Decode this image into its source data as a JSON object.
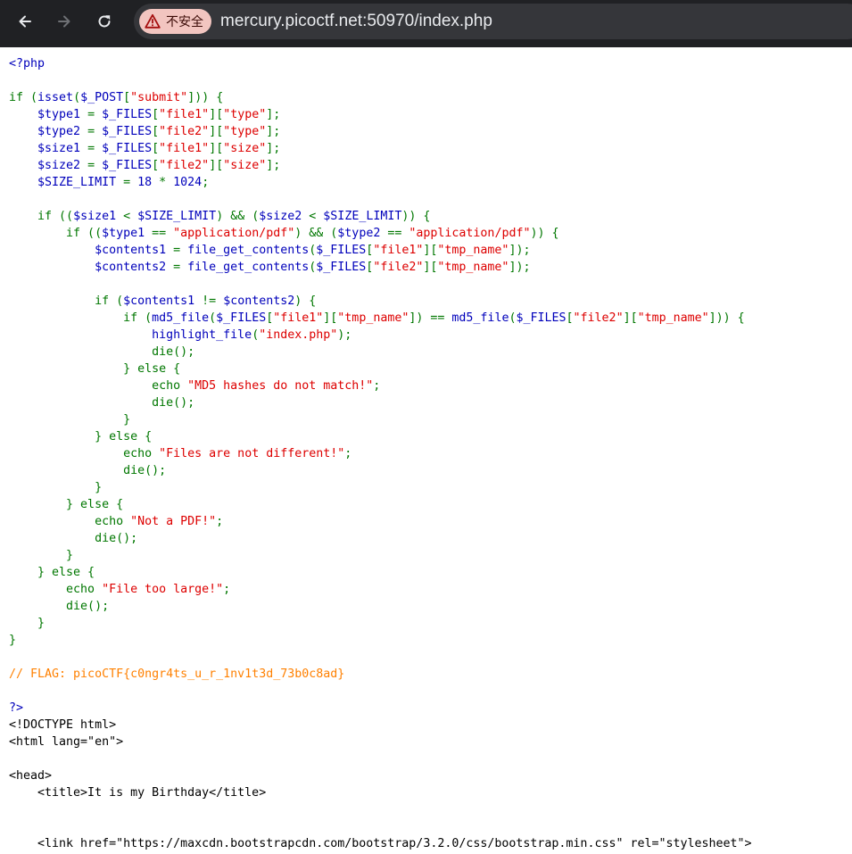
{
  "browser": {
    "security_label": "不安全",
    "url": "mercury.picoctf.net:50970/index.php",
    "icons": {
      "back": "arrow-left-icon",
      "forward": "arrow-right-icon",
      "reload": "reload-icon",
      "warning": "warning-triangle-icon"
    }
  },
  "colors": {
    "default": "#0000BB",
    "keyword": "#007700",
    "string": "#DD0000",
    "comment": "#FF8000",
    "html": "#000000"
  },
  "code_lines": [
    [
      [
        "default",
        "<?php"
      ]
    ],
    [],
    [
      [
        "keyword",
        "if ("
      ],
      [
        "default",
        "isset"
      ],
      [
        "keyword",
        "("
      ],
      [
        "default",
        "$_POST"
      ],
      [
        "keyword",
        "["
      ],
      [
        "string",
        "\"submit\""
      ],
      [
        "keyword",
        "])) {"
      ]
    ],
    [
      [
        "default",
        "    $type1 "
      ],
      [
        "keyword",
        "= "
      ],
      [
        "default",
        "$_FILES"
      ],
      [
        "keyword",
        "["
      ],
      [
        "string",
        "\"file1\""
      ],
      [
        "keyword",
        "]["
      ],
      [
        "string",
        "\"type\""
      ],
      [
        "keyword",
        "];"
      ]
    ],
    [
      [
        "default",
        "    $type2 "
      ],
      [
        "keyword",
        "= "
      ],
      [
        "default",
        "$_FILES"
      ],
      [
        "keyword",
        "["
      ],
      [
        "string",
        "\"file2\""
      ],
      [
        "keyword",
        "]["
      ],
      [
        "string",
        "\"type\""
      ],
      [
        "keyword",
        "];"
      ]
    ],
    [
      [
        "default",
        "    $size1 "
      ],
      [
        "keyword",
        "= "
      ],
      [
        "default",
        "$_FILES"
      ],
      [
        "keyword",
        "["
      ],
      [
        "string",
        "\"file1\""
      ],
      [
        "keyword",
        "]["
      ],
      [
        "string",
        "\"size\""
      ],
      [
        "keyword",
        "];"
      ]
    ],
    [
      [
        "default",
        "    $size2 "
      ],
      [
        "keyword",
        "= "
      ],
      [
        "default",
        "$_FILES"
      ],
      [
        "keyword",
        "["
      ],
      [
        "string",
        "\"file2\""
      ],
      [
        "keyword",
        "]["
      ],
      [
        "string",
        "\"size\""
      ],
      [
        "keyword",
        "];"
      ]
    ],
    [
      [
        "default",
        "    $SIZE_LIMIT "
      ],
      [
        "keyword",
        "= "
      ],
      [
        "default",
        "18 "
      ],
      [
        "keyword",
        "* "
      ],
      [
        "default",
        "1024"
      ],
      [
        "keyword",
        ";"
      ]
    ],
    [],
    [
      [
        "keyword",
        "    if (("
      ],
      [
        "default",
        "$size1 "
      ],
      [
        "keyword",
        "< "
      ],
      [
        "default",
        "$SIZE_LIMIT"
      ],
      [
        "keyword",
        ") && ("
      ],
      [
        "default",
        "$size2 "
      ],
      [
        "keyword",
        "< "
      ],
      [
        "default",
        "$SIZE_LIMIT"
      ],
      [
        "keyword",
        ")) {"
      ]
    ],
    [
      [
        "keyword",
        "        if (("
      ],
      [
        "default",
        "$type1 "
      ],
      [
        "keyword",
        "== "
      ],
      [
        "string",
        "\"application/pdf\""
      ],
      [
        "keyword",
        ") && ("
      ],
      [
        "default",
        "$type2 "
      ],
      [
        "keyword",
        "== "
      ],
      [
        "string",
        "\"application/pdf\""
      ],
      [
        "keyword",
        ")) {"
      ]
    ],
    [
      [
        "default",
        "            $contents1 "
      ],
      [
        "keyword",
        "= "
      ],
      [
        "default",
        "file_get_contents"
      ],
      [
        "keyword",
        "("
      ],
      [
        "default",
        "$_FILES"
      ],
      [
        "keyword",
        "["
      ],
      [
        "string",
        "\"file1\""
      ],
      [
        "keyword",
        "]["
      ],
      [
        "string",
        "\"tmp_name\""
      ],
      [
        "keyword",
        "]);"
      ]
    ],
    [
      [
        "default",
        "            $contents2 "
      ],
      [
        "keyword",
        "= "
      ],
      [
        "default",
        "file_get_contents"
      ],
      [
        "keyword",
        "("
      ],
      [
        "default",
        "$_FILES"
      ],
      [
        "keyword",
        "["
      ],
      [
        "string",
        "\"file2\""
      ],
      [
        "keyword",
        "]["
      ],
      [
        "string",
        "\"tmp_name\""
      ],
      [
        "keyword",
        "]);"
      ]
    ],
    [],
    [
      [
        "keyword",
        "            if ("
      ],
      [
        "default",
        "$contents1 "
      ],
      [
        "keyword",
        "!= "
      ],
      [
        "default",
        "$contents2"
      ],
      [
        "keyword",
        ") {"
      ]
    ],
    [
      [
        "keyword",
        "                if ("
      ],
      [
        "default",
        "md5_file"
      ],
      [
        "keyword",
        "("
      ],
      [
        "default",
        "$_FILES"
      ],
      [
        "keyword",
        "["
      ],
      [
        "string",
        "\"file1\""
      ],
      [
        "keyword",
        "]["
      ],
      [
        "string",
        "\"tmp_name\""
      ],
      [
        "keyword",
        "]) == "
      ],
      [
        "default",
        "md5_file"
      ],
      [
        "keyword",
        "("
      ],
      [
        "default",
        "$_FILES"
      ],
      [
        "keyword",
        "["
      ],
      [
        "string",
        "\"file2\""
      ],
      [
        "keyword",
        "]["
      ],
      [
        "string",
        "\"tmp_name\""
      ],
      [
        "keyword",
        "])) {"
      ]
    ],
    [
      [
        "default",
        "                    highlight_file"
      ],
      [
        "keyword",
        "("
      ],
      [
        "string",
        "\"index.php\""
      ],
      [
        "keyword",
        ");"
      ]
    ],
    [
      [
        "keyword",
        "                    die();"
      ]
    ],
    [
      [
        "keyword",
        "                } else {"
      ]
    ],
    [
      [
        "keyword",
        "                    echo "
      ],
      [
        "string",
        "\"MD5 hashes do not match!\""
      ],
      [
        "keyword",
        ";"
      ]
    ],
    [
      [
        "keyword",
        "                    die();"
      ]
    ],
    [
      [
        "keyword",
        "                }"
      ]
    ],
    [
      [
        "keyword",
        "            } else {"
      ]
    ],
    [
      [
        "keyword",
        "                echo "
      ],
      [
        "string",
        "\"Files are not different!\""
      ],
      [
        "keyword",
        ";"
      ]
    ],
    [
      [
        "keyword",
        "                die();"
      ]
    ],
    [
      [
        "keyword",
        "            }"
      ]
    ],
    [
      [
        "keyword",
        "        } else {"
      ]
    ],
    [
      [
        "keyword",
        "            echo "
      ],
      [
        "string",
        "\"Not a PDF!\""
      ],
      [
        "keyword",
        ";"
      ]
    ],
    [
      [
        "keyword",
        "            die();"
      ]
    ],
    [
      [
        "keyword",
        "        }"
      ]
    ],
    [
      [
        "keyword",
        "    } else {"
      ]
    ],
    [
      [
        "keyword",
        "        echo "
      ],
      [
        "string",
        "\"File too large!\""
      ],
      [
        "keyword",
        ";"
      ]
    ],
    [
      [
        "keyword",
        "        die();"
      ]
    ],
    [
      [
        "keyword",
        "    }"
      ]
    ],
    [
      [
        "keyword",
        "}"
      ]
    ],
    [],
    [
      [
        "comment",
        "// FLAG: picoCTF{c0ngr4ts_u_r_1nv1t3d_73b0c8ad}"
      ]
    ],
    [],
    [
      [
        "default",
        "?>"
      ]
    ],
    [
      [
        "html",
        "<!DOCTYPE html>"
      ]
    ],
    [
      [
        "html",
        "<html lang=\"en\">"
      ]
    ],
    [],
    [
      [
        "html",
        "<head>"
      ]
    ],
    [
      [
        "html",
        "    <title>It is my Birthday</title>"
      ]
    ],
    [],
    [],
    [
      [
        "html",
        "    <link href=\"https://maxcdn.bootstrapcdn.com/bootstrap/3.2.0/css/bootstrap.min.css\" rel=\"stylesheet\">"
      ]
    ]
  ]
}
